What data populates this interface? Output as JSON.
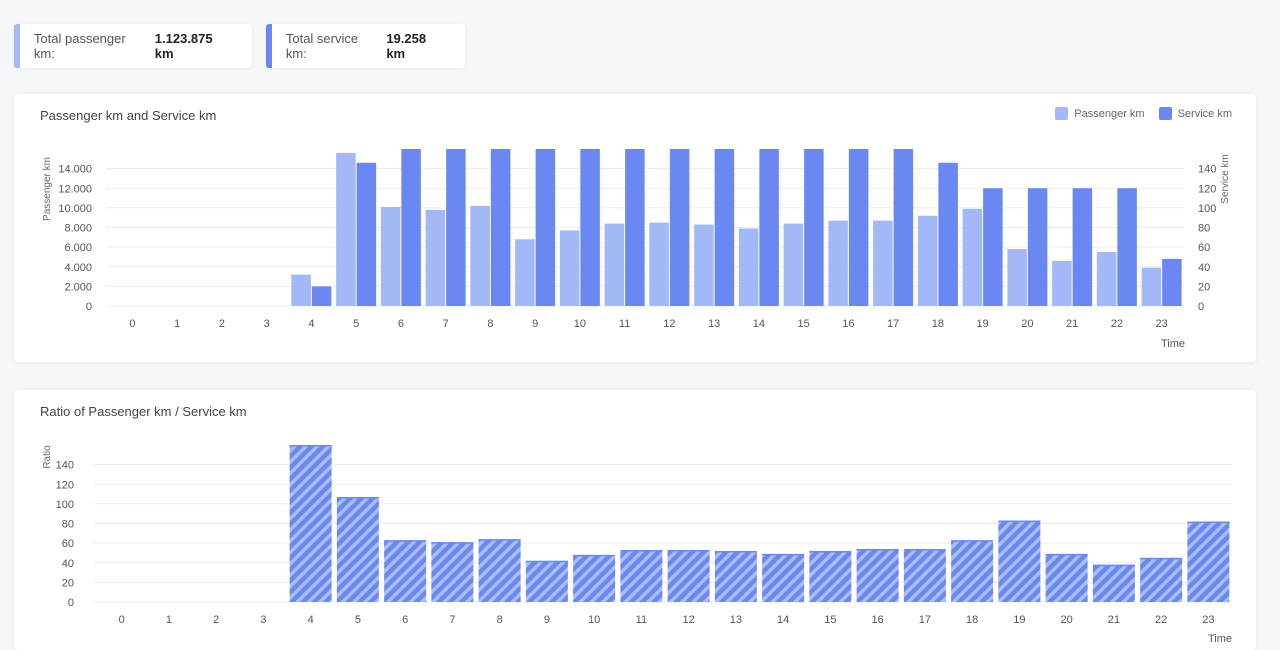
{
  "summary": {
    "passenger_label": "Total passenger km:",
    "passenger_value": "1.123.875 km",
    "service_label": "Total service km:",
    "service_value": "19.258 km"
  },
  "colors": {
    "passenger": "#a3b8f7",
    "service": "#6b88f2",
    "ratio": "#6b88f2",
    "grid": "#ececec",
    "axis_text": "#555"
  },
  "chart_data": [
    {
      "type": "bar",
      "title": "Passenger km and Service km",
      "xlabel": "Time",
      "ylabel": "Passenger km",
      "y2label": "Service km",
      "categories": [
        "0",
        "1",
        "2",
        "3",
        "4",
        "5",
        "6",
        "7",
        "8",
        "9",
        "10",
        "11",
        "12",
        "13",
        "14",
        "15",
        "16",
        "17",
        "18",
        "19",
        "20",
        "21",
        "22",
        "23"
      ],
      "ylim": [
        0,
        16000
      ],
      "yticks": [
        0,
        2000,
        4000,
        6000,
        8000,
        10000,
        12000,
        14000
      ],
      "yticklabels": [
        "0",
        "2.000",
        "4.000",
        "6.000",
        "8.000",
        "10.000",
        "12.000",
        "14.000"
      ],
      "y2lim": [
        0,
        160
      ],
      "y2ticks": [
        0,
        20,
        40,
        60,
        80,
        100,
        120,
        140
      ],
      "grid": true,
      "legend_position": "top-right",
      "series": [
        {
          "name": "Passenger km",
          "axis": "left",
          "values": [
            0,
            0,
            0,
            0,
            3200,
            15600,
            10100,
            9800,
            10200,
            6800,
            7700,
            8400,
            8500,
            8300,
            7900,
            8400,
            8700,
            8700,
            9200,
            9900,
            5800,
            4600,
            5500,
            3900
          ]
        },
        {
          "name": "Service km",
          "axis": "right",
          "values": [
            0,
            0,
            0,
            0,
            20,
            146,
            160,
            160,
            160,
            160,
            160,
            160,
            160,
            160,
            160,
            160,
            160,
            160,
            146,
            120,
            120,
            120,
            120,
            48
          ]
        }
      ]
    },
    {
      "type": "bar",
      "title": "Ratio of Passenger km / Service km",
      "xlabel": "Time",
      "ylabel": "Ratio",
      "categories": [
        "0",
        "1",
        "2",
        "3",
        "4",
        "5",
        "6",
        "7",
        "8",
        "9",
        "10",
        "11",
        "12",
        "13",
        "14",
        "15",
        "16",
        "17",
        "18",
        "19",
        "20",
        "21",
        "22",
        "23"
      ],
      "ylim": [
        0,
        160
      ],
      "yticks": [
        0,
        20,
        40,
        60,
        80,
        100,
        120,
        140
      ],
      "grid": true,
      "pattern": "diagonal-hatch",
      "values": [
        0,
        0,
        0,
        0,
        160,
        107,
        63,
        61,
        64,
        42,
        48,
        53,
        53,
        52,
        49,
        52,
        54,
        54,
        63,
        83,
        49,
        38,
        45,
        82
      ]
    }
  ]
}
